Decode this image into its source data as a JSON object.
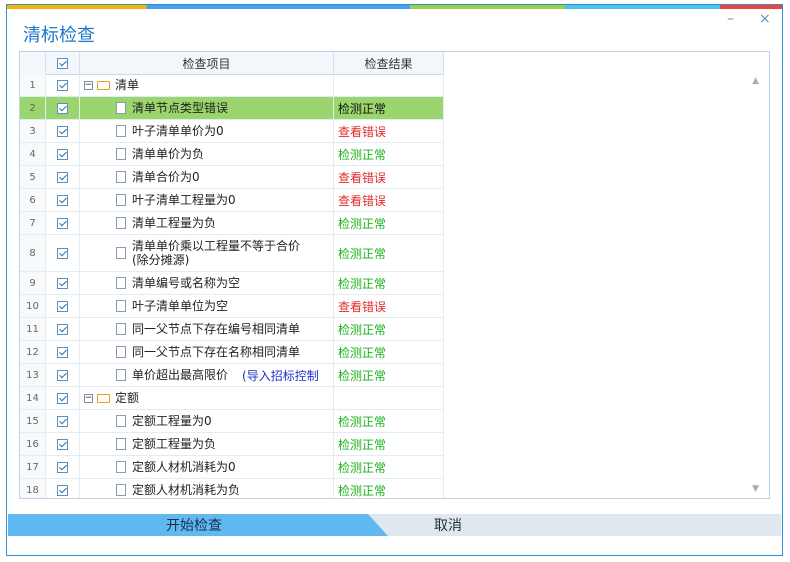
{
  "window": {
    "title": "清标检查",
    "minimize": "–",
    "close": "×"
  },
  "grid": {
    "header": {
      "item": "检查项目",
      "result": "检查结果"
    },
    "rows": [
      {
        "n": "1",
        "label": "清单",
        "type": "group",
        "result": "",
        "status": "none"
      },
      {
        "n": "2",
        "label": "清单节点类型错误",
        "type": "item",
        "result": "检测正常",
        "status": "sel"
      },
      {
        "n": "3",
        "label": "叶子清单单价为0",
        "type": "item",
        "result": "查看错误",
        "status": "err"
      },
      {
        "n": "4",
        "label": "清单单价为负",
        "type": "item",
        "result": "检测正常",
        "status": "ok"
      },
      {
        "n": "5",
        "label": "清单合价为0",
        "type": "item",
        "result": "查看错误",
        "status": "err"
      },
      {
        "n": "6",
        "label": "叶子清单工程量为0",
        "type": "item",
        "result": "查看错误",
        "status": "err"
      },
      {
        "n": "7",
        "label": "清单工程量为负",
        "type": "item",
        "result": "检测正常",
        "status": "ok"
      },
      {
        "n": "8",
        "label": "清单单价乘以工程量不等于合价\n(除分摊源)",
        "type": "item",
        "result": "检测正常",
        "status": "ok"
      },
      {
        "n": "9",
        "label": "清单编号或名称为空",
        "type": "item",
        "result": "检测正常",
        "status": "ok"
      },
      {
        "n": "10",
        "label": "叶子清单单位为空",
        "type": "item",
        "result": "查看错误",
        "status": "err"
      },
      {
        "n": "11",
        "label": "同一父节点下存在编号相同清单",
        "type": "item",
        "result": "检测正常",
        "status": "ok"
      },
      {
        "n": "12",
        "label": "同一父节点下存在名称相同清单",
        "type": "item",
        "result": "检测正常",
        "status": "ok"
      },
      {
        "n": "13",
        "label": "单价超出最高限价",
        "note": "(导入招标控制",
        "type": "item",
        "result": "检测正常",
        "status": "ok"
      },
      {
        "n": "14",
        "label": "定额",
        "type": "group",
        "result": "",
        "status": "none"
      },
      {
        "n": "15",
        "label": "定额工程量为0",
        "type": "item",
        "result": "检测正常",
        "status": "ok"
      },
      {
        "n": "16",
        "label": "定额工程量为负",
        "type": "item",
        "result": "检测正常",
        "status": "ok"
      },
      {
        "n": "17",
        "label": "定额人材机消耗为0",
        "type": "item",
        "result": "检测正常",
        "status": "ok"
      },
      {
        "n": "18",
        "label": "定额人材机消耗为负",
        "type": "item",
        "result": "检测正常",
        "status": "ok"
      }
    ]
  },
  "footer": {
    "start": "开始检查",
    "cancel": "取消"
  }
}
